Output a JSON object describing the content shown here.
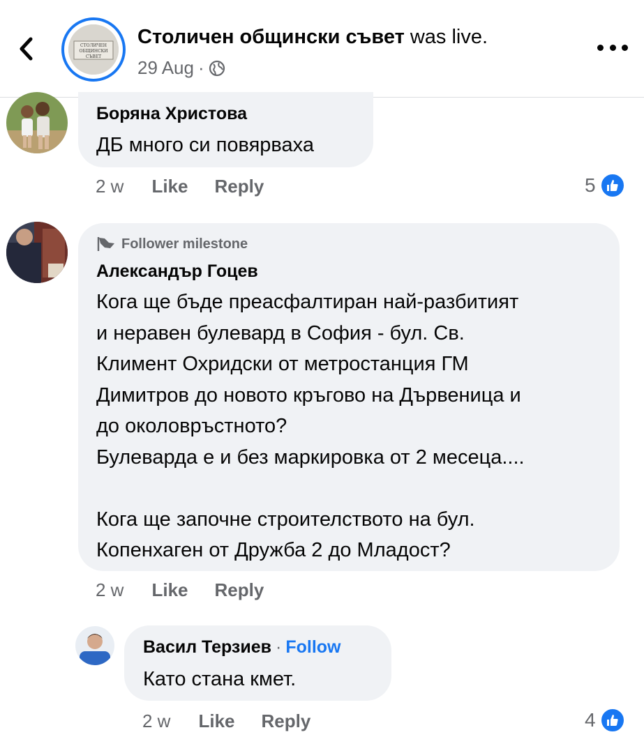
{
  "header": {
    "page_name": "Столичен общински съвет",
    "status_suffix": " was live.",
    "date": "29 Aug",
    "separator": "·",
    "avatar_text": "СТОЛИЧЕН ОБЩИНСКИ СЪВЕТ"
  },
  "comments": [
    {
      "author": "Боряна Христова",
      "text": "ДБ много си повярваха",
      "time": "2 w",
      "like_label": "Like",
      "reply_label": "Reply",
      "reaction_count": "5"
    },
    {
      "badge": "Follower milestone",
      "author": "Александър Гоцев",
      "lines": [
        "Кога ще бъде преасфалтиран най-разбитият",
        "и неравен булевард в София - бул. Св.",
        "Климент Охридски от метростанция ГМ",
        "Димитров до новото кръгово на Дървеница и",
        "до околовръстното?",
        "Булеварда е и без маркировка от 2 месеца....",
        "",
        "Кога ще започне строителството на бул.",
        "Копенхаген от Дружба 2 до Младост?"
      ],
      "time": "2 w",
      "like_label": "Like",
      "reply_label": "Reply"
    }
  ],
  "reply": {
    "author": "Васил Терзиев",
    "separator": "·",
    "follow_label": "Follow",
    "text": "Като стана кмет.",
    "time": "2 w",
    "like_label": "Like",
    "reply_label": "Reply",
    "reaction_count": "4"
  },
  "colors": {
    "accent": "#1877f2",
    "bubble": "#f0f2f5",
    "secondary_text": "#65676b"
  },
  "icons": {
    "back": "chevron-left-icon",
    "privacy": "globe-icon",
    "more": "more-icon",
    "like": "thumbs-up-icon",
    "milestone": "flag-icon"
  }
}
